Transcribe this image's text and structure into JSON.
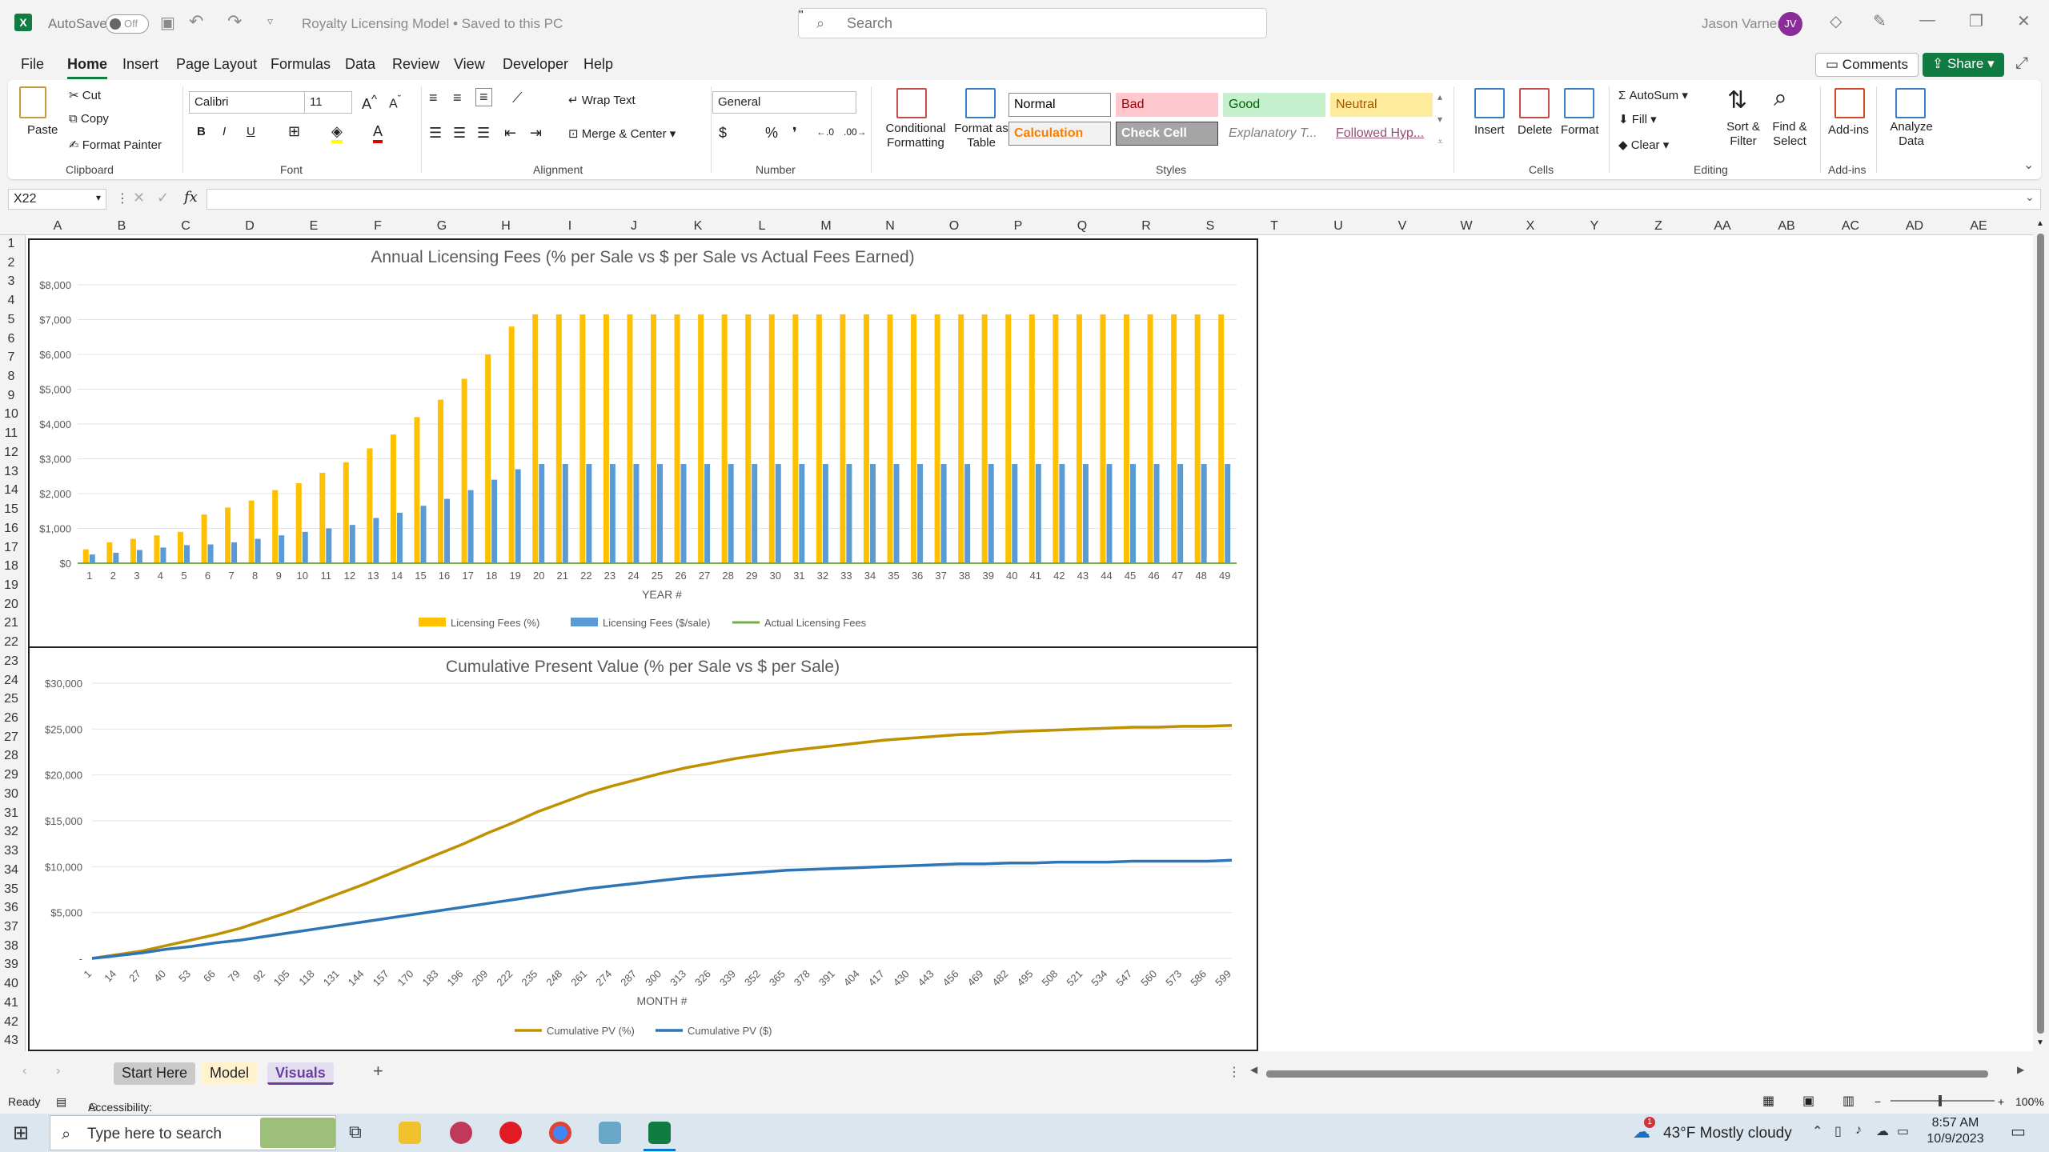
{
  "titlebar": {
    "autosave_label": "AutoSave",
    "autosave_state": "Off",
    "document_title": "Royalty Licensing Model • Saved to this PC",
    "search_placeholder": "Search",
    "user_name": "Jason Varner",
    "user_initials": "JV"
  },
  "menu": {
    "tabs": [
      "File",
      "Home",
      "Insert",
      "Page Layout",
      "Formulas",
      "Data",
      "Review",
      "View",
      "Developer",
      "Help"
    ],
    "active": "Home",
    "comments_label": "Comments",
    "share_label": "Share"
  },
  "ribbon": {
    "clipboard": {
      "paste": "Paste",
      "cut": "Cut",
      "copy": "Copy",
      "format_painter": "Format Painter",
      "group": "Clipboard"
    },
    "font": {
      "name": "Calibri",
      "size": "11",
      "group": "Font"
    },
    "alignment": {
      "wrap_text": "Wrap Text",
      "merge_center": "Merge & Center",
      "group": "Alignment"
    },
    "number": {
      "format": "General",
      "group": "Number"
    },
    "styles": {
      "conditional_formatting": "Conditional Formatting",
      "format_as_table": "Format as Table",
      "group": "Styles",
      "cells": [
        {
          "label": "Normal",
          "bg": "#ffffff",
          "fg": "#000000",
          "border": "#8a8a8a"
        },
        {
          "label": "Bad",
          "bg": "#ffc7ce",
          "fg": "#9c0006",
          "border": "#ffc7ce"
        },
        {
          "label": "Good",
          "bg": "#c6efce",
          "fg": "#006100",
          "border": "#c6efce"
        },
        {
          "label": "Neutral",
          "bg": "#ffeb9c",
          "fg": "#9c5700",
          "border": "#ffeb9c"
        },
        {
          "label": "Calculation",
          "bg": "#f2f2f2",
          "fg": "#fa7d00",
          "border": "#7f7f7f"
        },
        {
          "label": "Check Cell",
          "bg": "#a5a5a5",
          "fg": "#ffffff",
          "border": "#3f3f3f"
        },
        {
          "label": "Explanatory T...",
          "bg": "#ffffff",
          "fg": "#7f7f7f",
          "border": "#ffffff"
        },
        {
          "label": "Followed Hyp...",
          "bg": "#ffffff",
          "fg": "#954f72",
          "border": "#ffffff"
        }
      ]
    },
    "cells": {
      "insert": "Insert",
      "delete": "Delete",
      "format": "Format",
      "group": "Cells"
    },
    "editing": {
      "autosum": "AutoSum",
      "fill": "Fill",
      "clear": "Clear",
      "sort_filter": "Sort & Filter",
      "find_select": "Find & Select",
      "group": "Editing"
    },
    "addins": {
      "addins": "Add-ins",
      "analyze": "Analyze Data",
      "group": "Add-ins"
    }
  },
  "formula_bar": {
    "name_box": "X22",
    "formula": ""
  },
  "columns": [
    "A",
    "B",
    "C",
    "D",
    "E",
    "F",
    "G",
    "H",
    "I",
    "J",
    "K",
    "L",
    "M",
    "N",
    "O",
    "P",
    "Q",
    "R",
    "S",
    "T",
    "U",
    "V",
    "W",
    "X",
    "Y",
    "Z",
    "AA",
    "AB",
    "AC",
    "AD",
    "AE"
  ],
  "rows": [
    1,
    2,
    3,
    4,
    5,
    6,
    7,
    8,
    9,
    10,
    11,
    12,
    13,
    14,
    15,
    16,
    17,
    18,
    19,
    20,
    21,
    22,
    23,
    24,
    25,
    26,
    27,
    28,
    29,
    30,
    31,
    32,
    33,
    34,
    35,
    36,
    37,
    38,
    39,
    40,
    41,
    42,
    43
  ],
  "chart_data": [
    {
      "type": "bar",
      "title": "Annual Licensing Fees (% per Sale vs $ per Sale vs Actual Fees Earned)",
      "xlabel": "YEAR #",
      "ylabel": "",
      "ylim": [
        0,
        8000
      ],
      "yticks": [
        "$0",
        "$1,000",
        "$2,000",
        "$3,000",
        "$4,000",
        "$5,000",
        "$6,000",
        "$7,000",
        "$8,000"
      ],
      "categories": [
        1,
        2,
        3,
        4,
        5,
        6,
        7,
        8,
        9,
        10,
        11,
        12,
        13,
        14,
        15,
        16,
        17,
        18,
        19,
        20,
        21,
        22,
        23,
        24,
        25,
        26,
        27,
        28,
        29,
        30,
        31,
        32,
        33,
        34,
        35,
        36,
        37,
        38,
        39,
        40,
        41,
        42,
        43,
        44,
        45,
        46,
        47,
        48,
        49
      ],
      "series": [
        {
          "name": "Licensing Fees (%)",
          "color": "#ffc000",
          "values": [
            400,
            600,
            700,
            800,
            900,
            1400,
            1600,
            1800,
            2100,
            2300,
            2600,
            2900,
            3300,
            3700,
            4200,
            4700,
            5300,
            6000,
            6800,
            7150,
            7150,
            7150,
            7150,
            7150,
            7150,
            7150,
            7150,
            7150,
            7150,
            7150,
            7150,
            7150,
            7150,
            7150,
            7150,
            7150,
            7150,
            7150,
            7150,
            7150,
            7150,
            7150,
            7150,
            7150,
            7150,
            7150,
            7150,
            7150,
            7150
          ]
        },
        {
          "name": "Licensing Fees ($/sale)",
          "color": "#5b9bd5",
          "values": [
            250,
            300,
            380,
            450,
            520,
            540,
            600,
            700,
            800,
            900,
            1000,
            1100,
            1300,
            1450,
            1650,
            1850,
            2100,
            2400,
            2700,
            2850,
            2850,
            2850,
            2850,
            2850,
            2850,
            2850,
            2850,
            2850,
            2850,
            2850,
            2850,
            2850,
            2850,
            2850,
            2850,
            2850,
            2850,
            2850,
            2850,
            2850,
            2850,
            2850,
            2850,
            2850,
            2850,
            2850,
            2850,
            2850,
            2850
          ]
        },
        {
          "name": "Actual Licensing Fees",
          "color": "#70ad47",
          "values": [
            0,
            0,
            0,
            0,
            0,
            0,
            0,
            0,
            0,
            0,
            0,
            0,
            0,
            0,
            0,
            0,
            0,
            0,
            0,
            0,
            0,
            0,
            0,
            0,
            0,
            0,
            0,
            0,
            0,
            0,
            0,
            0,
            0,
            0,
            0,
            0,
            0,
            0,
            0,
            0,
            0,
            0,
            0,
            0,
            0,
            0,
            0,
            0,
            0
          ]
        }
      ]
    },
    {
      "type": "line",
      "title": "Cumulative Present Value (% per Sale vs $ per Sale)",
      "xlabel": "MONTH #",
      "ylabel": "",
      "ylim": [
        0,
        30000
      ],
      "yticks": [
        "-",
        "$5,000",
        "$10,000",
        "$15,000",
        "$20,000",
        "$25,000",
        "$30,000"
      ],
      "categories": [
        1,
        14,
        27,
        40,
        53,
        66,
        79,
        92,
        105,
        118,
        131,
        144,
        157,
        170,
        183,
        196,
        209,
        222,
        235,
        248,
        261,
        274,
        287,
        300,
        313,
        326,
        339,
        352,
        365,
        378,
        391,
        404,
        417,
        430,
        443,
        456,
        469,
        482,
        495,
        508,
        521,
        534,
        547,
        560,
        573,
        586,
        599
      ],
      "series": [
        {
          "name": "Cumulative PV (%)",
          "color": "#bf9000",
          "values": [
            0,
            400,
            800,
            1400,
            2000,
            2600,
            3300,
            4200,
            5100,
            6100,
            7100,
            8100,
            9200,
            10300,
            11400,
            12500,
            13700,
            14800,
            16000,
            17000,
            18000,
            18800,
            19500,
            20200,
            20800,
            21300,
            21800,
            22200,
            22600,
            22900,
            23200,
            23500,
            23800,
            24000,
            24200,
            24400,
            24500,
            24700,
            24800,
            24900,
            25000,
            25100,
            25200,
            25200,
            25300,
            25300,
            25400
          ]
        },
        {
          "name": "Cumulative PV ($)",
          "color": "#2e75b6",
          "values": [
            0,
            300,
            600,
            1000,
            1300,
            1700,
            2000,
            2400,
            2800,
            3200,
            3600,
            4000,
            4400,
            4800,
            5200,
            5600,
            6000,
            6400,
            6800,
            7200,
            7600,
            7900,
            8200,
            8500,
            8800,
            9000,
            9200,
            9400,
            9600,
            9700,
            9800,
            9900,
            10000,
            10100,
            10200,
            10300,
            10300,
            10400,
            10400,
            10500,
            10500,
            10500,
            10600,
            10600,
            10600,
            10600,
            10700
          ]
        }
      ]
    }
  ],
  "sheet_tabs": [
    {
      "label": "Start Here",
      "bg": "#c9c9c9",
      "fg": "#222222"
    },
    {
      "label": "Model",
      "bg": "#fff2cc",
      "fg": "#222222"
    },
    {
      "label": "Visuals",
      "bg": "#e4dff0",
      "fg": "#6b3fa0"
    }
  ],
  "statusbar": {
    "ready": "Ready",
    "accessibility": "Accessibility: Investigate",
    "zoom": "100%"
  },
  "taskbar": {
    "search_placeholder": "Type here to search",
    "weather": "43°F  Mostly cloudy",
    "time": "8:57 AM",
    "date": "10/9/2023",
    "weather_badge": "1"
  }
}
